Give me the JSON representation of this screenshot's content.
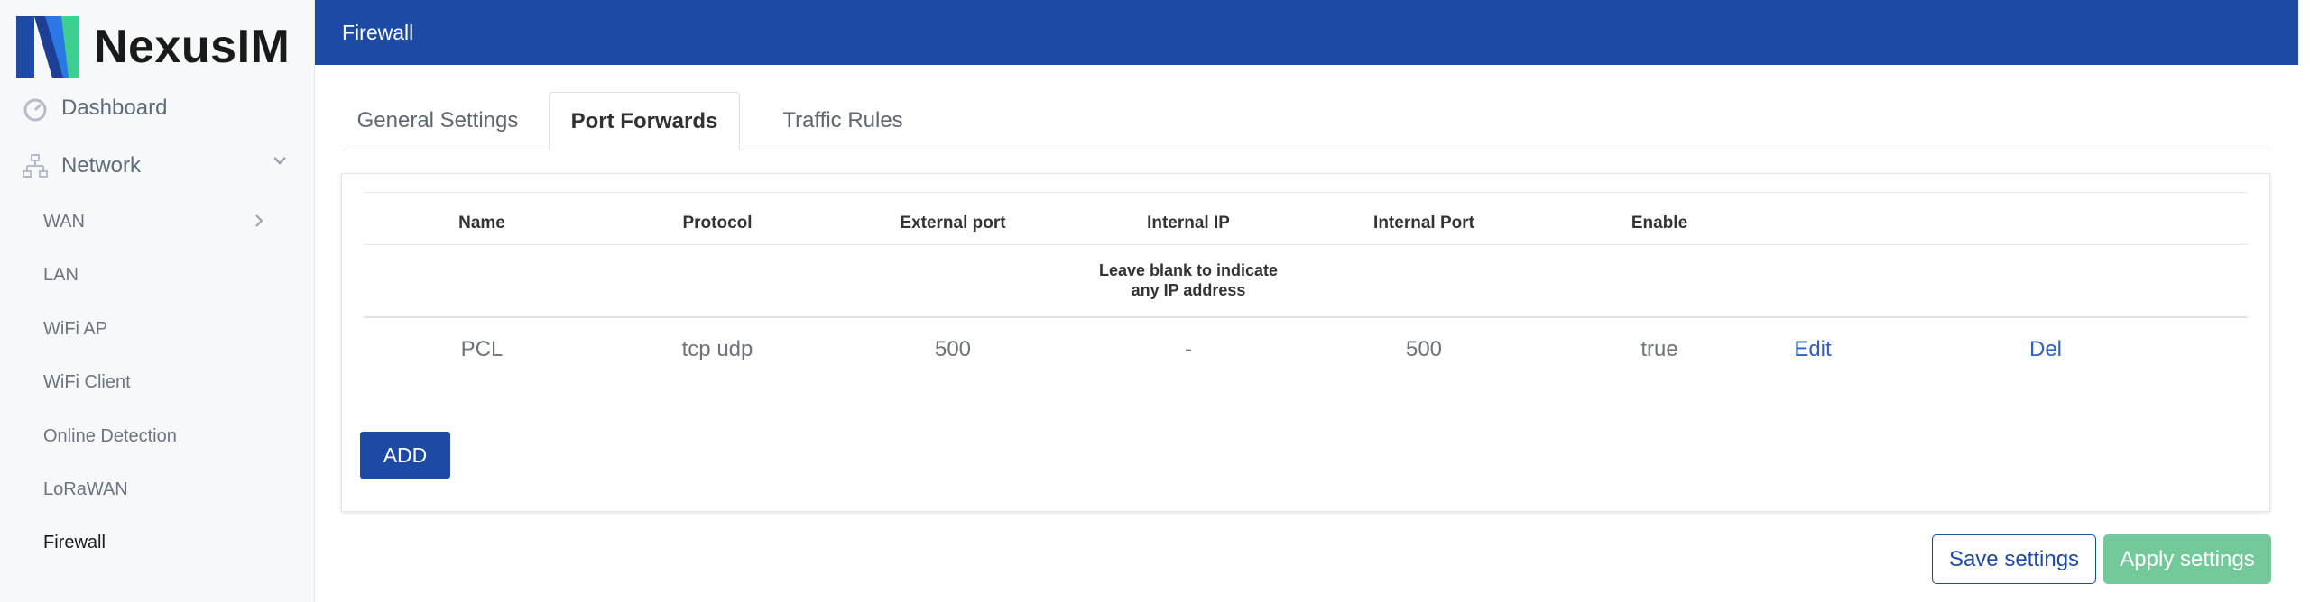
{
  "brand": {
    "name": "NexusIM"
  },
  "sidebar": {
    "top_items": [
      {
        "label": "Dashboard",
        "icon": "dashboard-icon"
      },
      {
        "label": "Network",
        "icon": "network-icon",
        "expanded": true
      }
    ],
    "sub_items": [
      {
        "label": "WAN",
        "has_children": true
      },
      {
        "label": "LAN"
      },
      {
        "label": "WiFi AP"
      },
      {
        "label": "WiFi Client"
      },
      {
        "label": "Online Detection"
      },
      {
        "label": "LoRaWAN"
      },
      {
        "label": "Firewall",
        "active": true
      }
    ]
  },
  "header": {
    "title": "Firewall"
  },
  "tabs": [
    {
      "label": "General Settings"
    },
    {
      "label": "Port Forwards",
      "active": true
    },
    {
      "label": "Traffic Rules"
    }
  ],
  "table": {
    "columns": [
      "Name",
      "Protocol",
      "External port",
      "Internal IP",
      "Internal Port",
      "Enable"
    ],
    "hint_line1": "Leave blank to indicate",
    "hint_line2": "any IP address",
    "rows": [
      {
        "name": "PCL",
        "protocol": "tcp udp",
        "external_port": "500",
        "internal_ip": "-",
        "internal_port": "500",
        "enable": "true",
        "edit_label": "Edit",
        "delete_label": "Del"
      }
    ]
  },
  "buttons": {
    "add": "ADD",
    "save": "Save settings",
    "apply": "Apply settings"
  },
  "colors": {
    "primary": "#1c4aa4",
    "apply": "#74c99a",
    "link": "#2c5fc7"
  }
}
